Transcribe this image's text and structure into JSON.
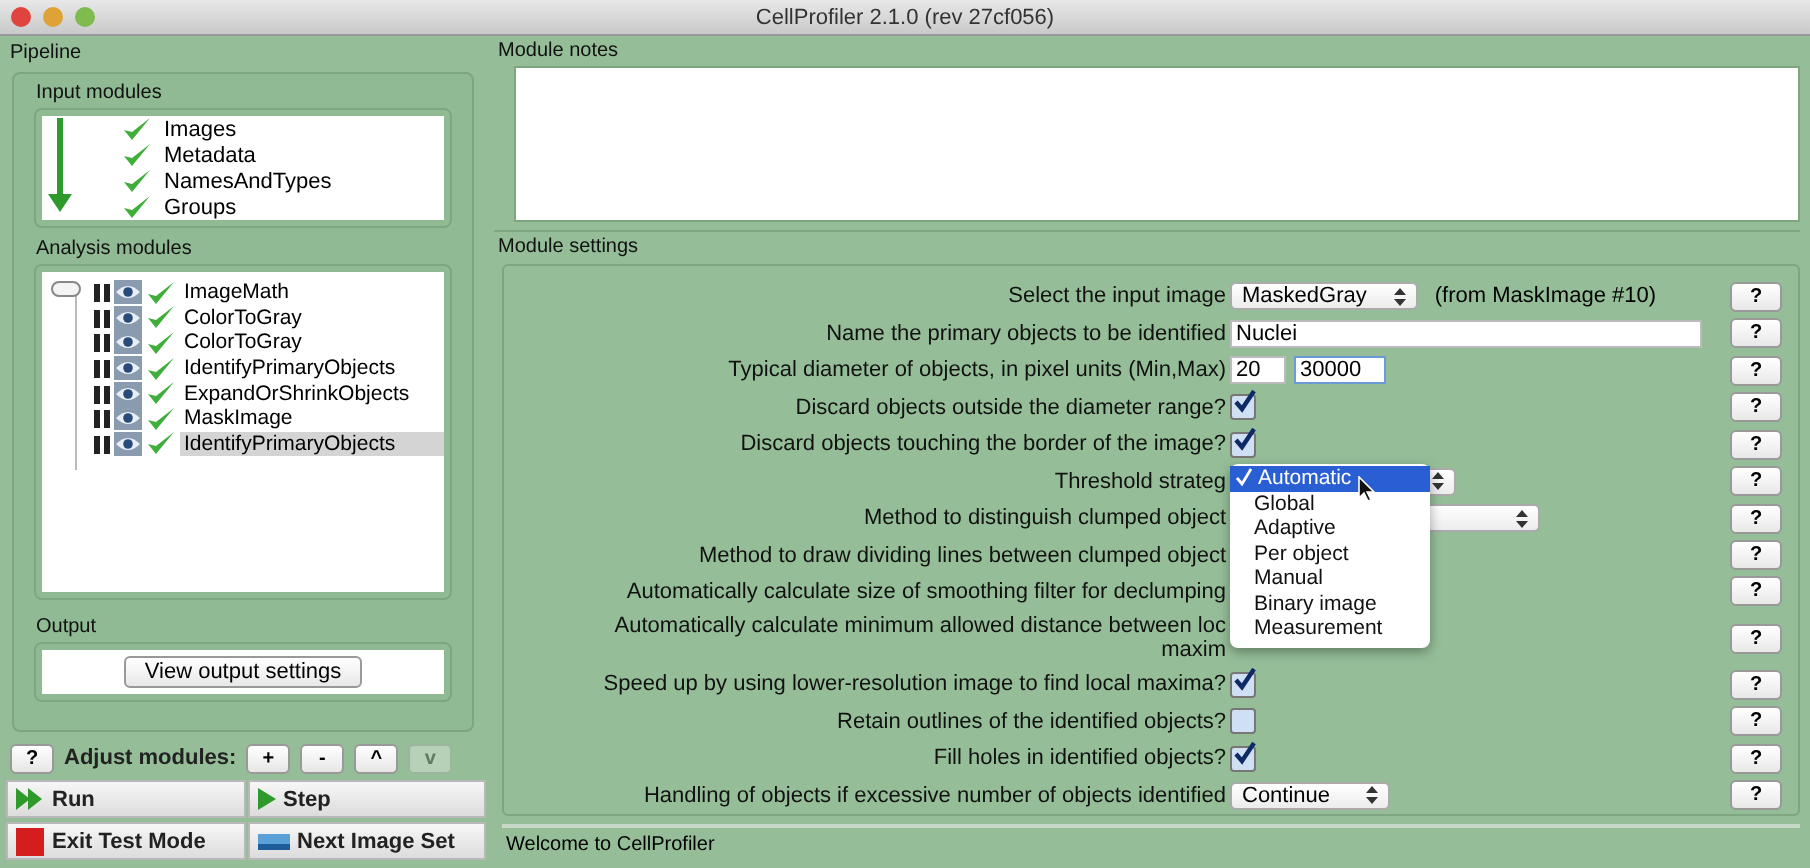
{
  "window": {
    "title": "CellProfiler 2.1.0 (rev 27cf056)"
  },
  "pipeline": {
    "title": "Pipeline",
    "input_modules": {
      "title": "Input modules",
      "items": [
        {
          "name": "Images",
          "checked": true
        },
        {
          "name": "Metadata",
          "checked": true
        },
        {
          "name": "NamesAndTypes",
          "checked": true
        },
        {
          "name": "Groups",
          "checked": true
        }
      ]
    },
    "analysis_modules": {
      "title": "Analysis modules",
      "items": [
        {
          "name": "ImageMath",
          "checked": true,
          "selected": false
        },
        {
          "name": "ColorToGray",
          "checked": true,
          "selected": false
        },
        {
          "name": "ColorToGray",
          "checked": true,
          "selected": false
        },
        {
          "name": "IdentifyPrimaryObjects",
          "checked": true,
          "selected": false
        },
        {
          "name": "ExpandOrShrinkObjects",
          "checked": true,
          "selected": false
        },
        {
          "name": "MaskImage",
          "checked": true,
          "selected": false
        },
        {
          "name": "IdentifyPrimaryObjects",
          "checked": true,
          "selected": true
        }
      ]
    },
    "output": {
      "title": "Output",
      "button": "View output settings"
    },
    "help_button": "?",
    "adjust_label": "Adjust modules:",
    "adjust_buttons": [
      {
        "label": "+",
        "disabled": false
      },
      {
        "label": "-",
        "disabled": false
      },
      {
        "label": "^",
        "disabled": false
      },
      {
        "label": "v",
        "disabled": true
      }
    ],
    "actions": [
      {
        "label": "Run",
        "kind": "run"
      },
      {
        "label": "Step",
        "kind": "step"
      },
      {
        "label": "Exit Test Mode",
        "kind": "stop"
      },
      {
        "label": "Next Image Set",
        "kind": "next"
      }
    ]
  },
  "module_notes": {
    "title": "Module notes"
  },
  "settings": {
    "title": "Module settings",
    "help": "?",
    "rows": [
      {
        "kind": "select",
        "label": "Select the input image",
        "value": "MaskedGray",
        "note": "(from MaskImage #10)"
      },
      {
        "kind": "text",
        "label": "Name the primary objects to be identified",
        "value": "Nuclei"
      },
      {
        "kind": "range",
        "label": "Typical diameter of objects, in pixel units (Min,Max)",
        "values": [
          "20",
          "30000"
        ]
      },
      {
        "kind": "checkbox",
        "label": "Discard objects outside the diameter range?",
        "checked": true
      },
      {
        "kind": "checkbox",
        "label": "Discard objects touching the border of the image?",
        "checked": true
      },
      {
        "kind": "select",
        "label": "Threshold strateg",
        "menu": [
          {
            "label": "Automatic",
            "selected": true
          },
          {
            "label": "Global",
            "selected": false
          },
          {
            "label": "Adaptive",
            "selected": false
          },
          {
            "label": "Per object",
            "selected": false
          },
          {
            "label": "Manual",
            "selected": false
          },
          {
            "label": "Binary image",
            "selected": false
          },
          {
            "label": "Measurement",
            "selected": false
          }
        ]
      },
      {
        "kind": "select",
        "label": "Method to distinguish clumped object"
      },
      {
        "kind": "label",
        "label": "Method to draw dividing lines between clumped object"
      },
      {
        "kind": "label",
        "label": "Automatically calculate size of smoothing filter for declumping"
      },
      {
        "kind": "label",
        "label_lines": [
          "Automatically calculate minimum allowed distance between loc",
          "maxim"
        ]
      },
      {
        "kind": "checkbox",
        "label": "Speed up by using lower-resolution image to find local maxima?",
        "checked": true
      },
      {
        "kind": "checkbox",
        "label": "Retain outlines of the identified objects?",
        "checked": false
      },
      {
        "kind": "checkbox",
        "label": "Fill holes in identified objects?",
        "checked": true
      },
      {
        "kind": "select",
        "label": "Handling of objects if excessive number of objects identified",
        "value": "Continue"
      }
    ]
  },
  "status_bar": {
    "text": "Welcome to CellProfiler"
  }
}
